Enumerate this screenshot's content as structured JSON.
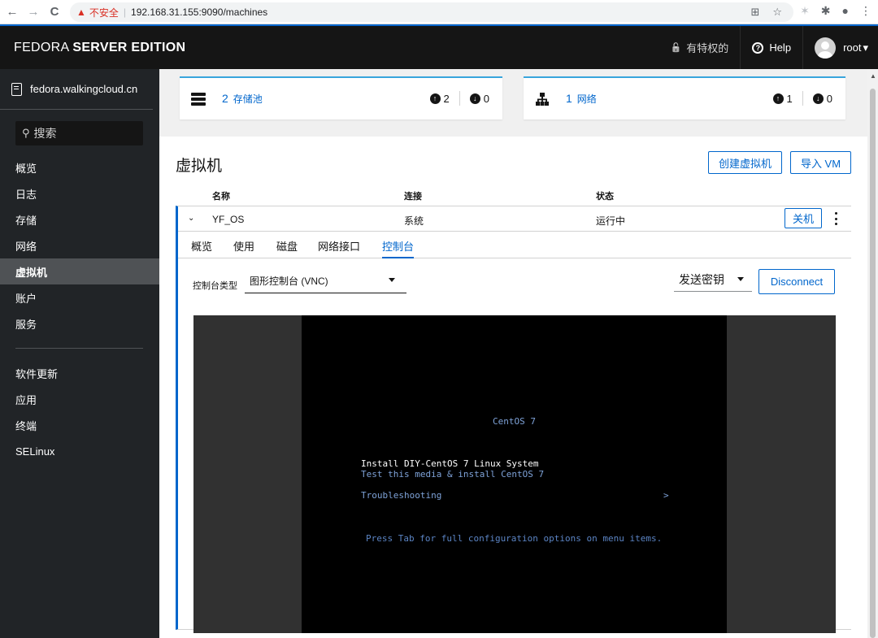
{
  "browser": {
    "back_glyph": "←",
    "forward_glyph": "→",
    "reload_glyph": "C",
    "warning_glyph": "▲",
    "insecure_label": "不安全",
    "separator": "|",
    "url": "192.168.31.155:9090/machines",
    "translate_glyph": "⊞",
    "star_glyph": "☆",
    "ext1_glyph": "✶",
    "puzzle_glyph": "✱",
    "profile_glyph": "●",
    "menu_glyph": "⋮"
  },
  "header": {
    "brand_light": "FEDORA ",
    "brand_bold": "SERVER EDITION",
    "lock_glyph": "🔓",
    "privileged_label": "有特权的",
    "help_glyph": "?",
    "help_label": "Help",
    "user_label": "root",
    "user_caret": "▾"
  },
  "sidebar": {
    "host": "fedora.walkingcloud.cn",
    "search_glyph": "⚲",
    "search_label": "搜索",
    "nav_primary": [
      {
        "label": "概览"
      },
      {
        "label": "日志"
      },
      {
        "label": "存储"
      },
      {
        "label": "网络"
      },
      {
        "label": "虚拟机"
      },
      {
        "label": "账户"
      },
      {
        "label": "服务"
      }
    ],
    "nav_secondary": [
      {
        "label": "软件更新"
      },
      {
        "label": "应用"
      },
      {
        "label": "终端"
      },
      {
        "label": "SELinux"
      }
    ]
  },
  "cards": {
    "pools": {
      "count": "2",
      "label": "存储池",
      "up": "2",
      "down": "0"
    },
    "networks": {
      "count": "1",
      "label": "网络",
      "up": "1",
      "down": "0"
    },
    "up_glyph": "↑",
    "down_glyph": "↓"
  },
  "vms": {
    "title": "虚拟机",
    "create_label": "创建虚拟机",
    "import_label": "导入 VM",
    "columns": {
      "name": "名称",
      "connection": "连接",
      "state": "状态"
    },
    "row": {
      "chevron": "⌄",
      "name": "YF_OS",
      "connection": "系统",
      "state": "运行中",
      "shutdown_label": "关机"
    },
    "tabs": [
      {
        "label": "概览"
      },
      {
        "label": "使用"
      },
      {
        "label": "磁盘"
      },
      {
        "label": "网络接口"
      },
      {
        "label": "控制台"
      }
    ],
    "console": {
      "type_label": "控制台类型",
      "type_value": "图形控制台 (VNC)",
      "send_key_label": "发送密钥",
      "disconnect_label": "Disconnect"
    }
  },
  "vnc": {
    "title": "CentOS 7",
    "option1": "Install DIY-CentOS 7 Linux System",
    "option2": "Test this media & install CentOS 7",
    "option3": "Troubleshooting",
    "arrow": ">",
    "hint": "Press Tab for full configuration options on menu items."
  },
  "colors": {
    "accent": "#0066cc",
    "header_bg": "#151515",
    "sidebar_bg": "#212427",
    "card_border": "#39a5dc"
  }
}
